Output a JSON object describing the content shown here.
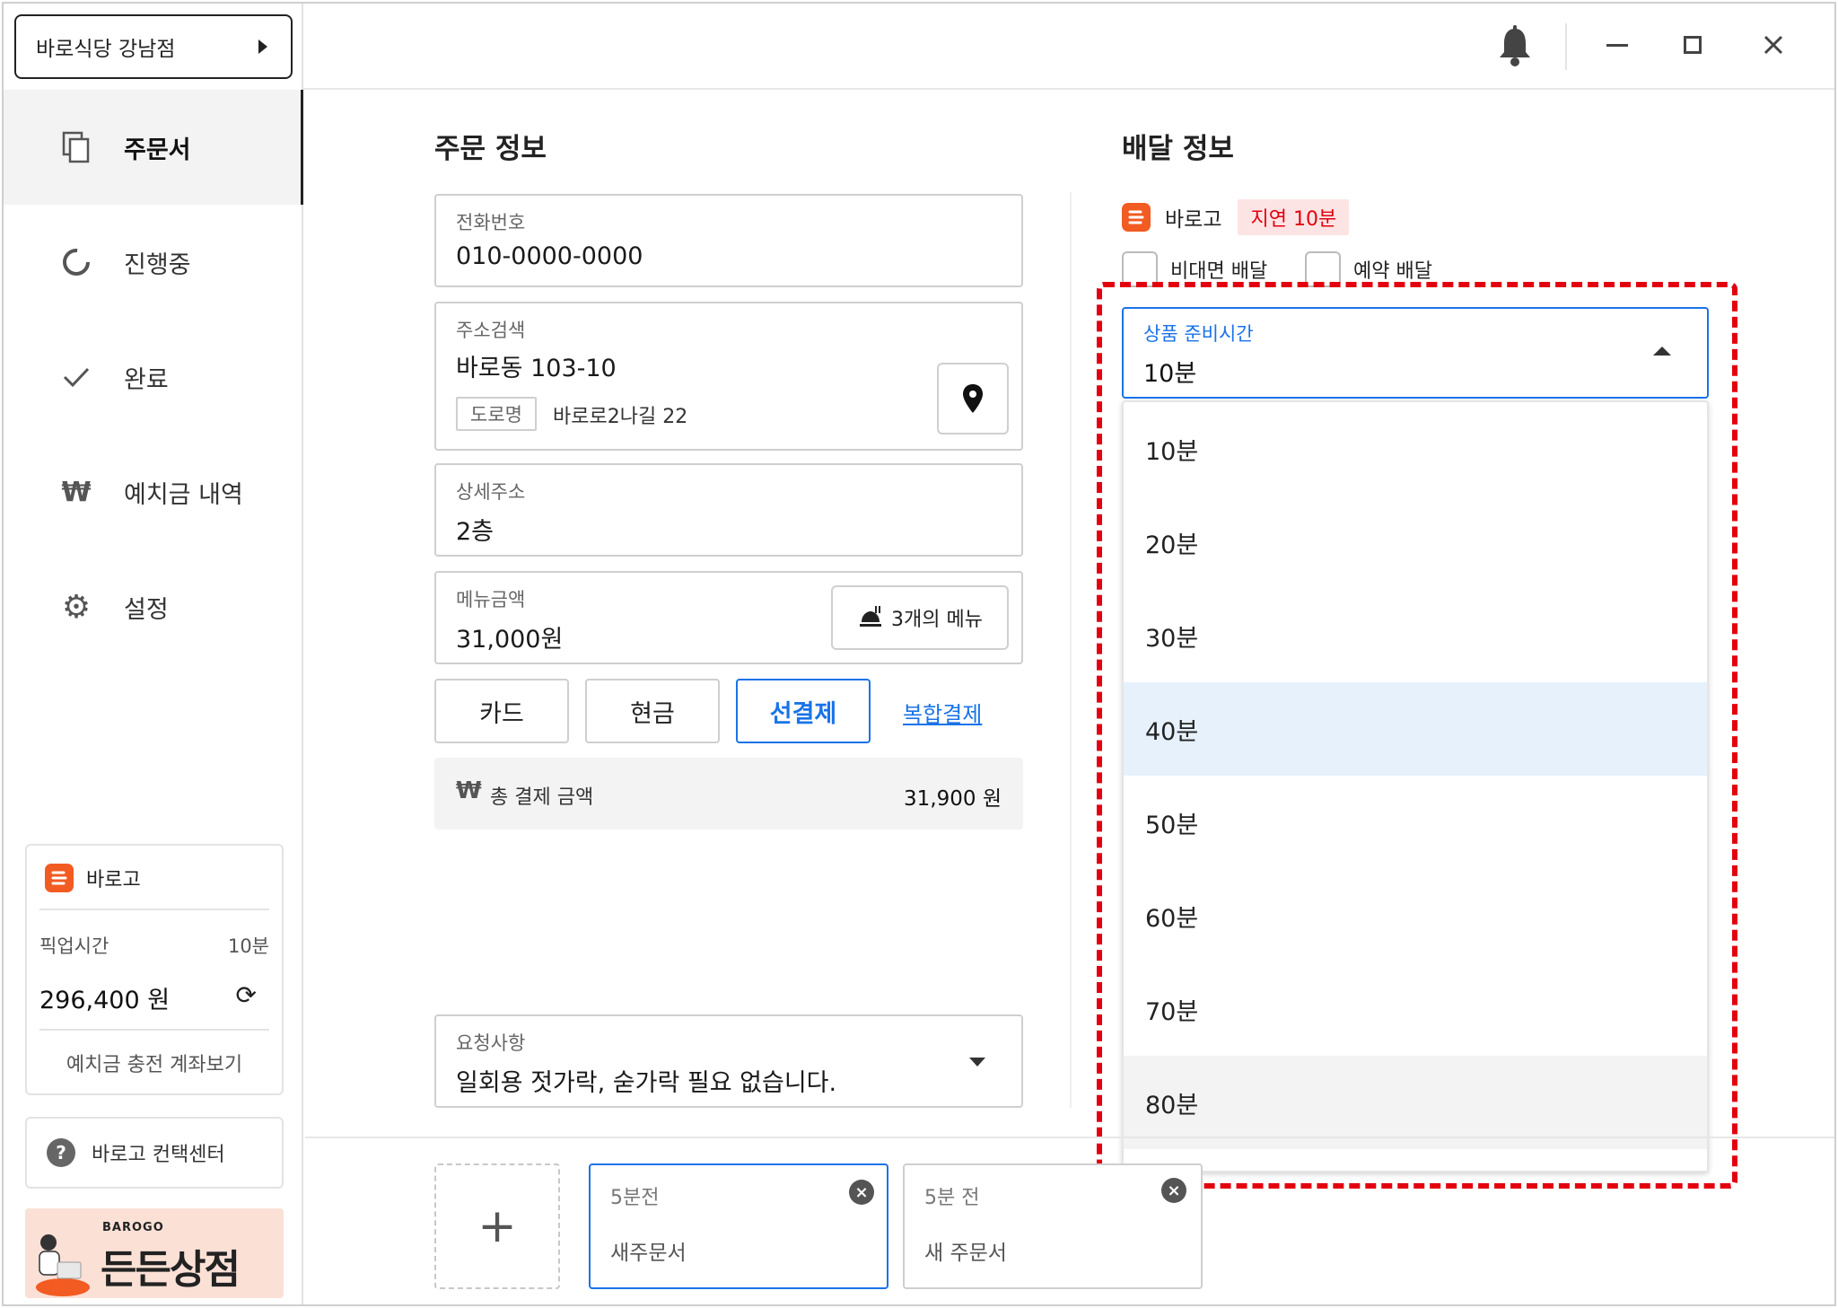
{
  "sidebar": {
    "store_name": "바로식당 강남점",
    "nav": [
      {
        "label": "주문서",
        "icon": "copy-icon"
      },
      {
        "label": "진행중",
        "icon": "progress-ring-icon"
      },
      {
        "label": "완료",
        "icon": "check-icon"
      },
      {
        "label": "예치금 내역",
        "icon": "won-icon"
      },
      {
        "label": "설정",
        "icon": "gear-icon"
      }
    ],
    "card": {
      "brand": "바로고",
      "pickup_label": "픽업시간",
      "pickup_value": "10분",
      "balance": "296,400 원",
      "deposit_link": "예치금 충전 계좌보기"
    },
    "help_label": "바로고 컨택센터",
    "banner": {
      "brand": "BAROGO",
      "title": "든든상점"
    }
  },
  "order_info": {
    "title": "주문 정보",
    "phone": {
      "label": "전화번호",
      "value": "010-0000-0000"
    },
    "address": {
      "label": "주소검색",
      "value": "바로동 103-10",
      "road_tag": "도로명",
      "road_value": "바로로2나길 22"
    },
    "detail": {
      "label": "상세주소",
      "value": "2층"
    },
    "menu": {
      "label": "메뉴금액",
      "value": "31,000원",
      "menu_button": "3개의 메뉴"
    },
    "payment": {
      "options": [
        "카드",
        "현금",
        "선결제"
      ],
      "selected": "선결제",
      "combo_link": "복합결제"
    },
    "total": {
      "label": "총 결제 금액",
      "value": "31,900 원"
    },
    "request": {
      "label": "요청사항",
      "value": "일회용 젓가락, 숟가락 필요 없습니다."
    }
  },
  "delivery_info": {
    "title": "배달 정보",
    "brand": "바로고",
    "delay_badge": "지연 10분",
    "contactless": "비대면 배달",
    "reserve": "예약 배달",
    "prep_time": {
      "label": "상품 준비시간",
      "value": "10분"
    },
    "options": [
      "10분",
      "20분",
      "30분",
      "40분",
      "50분",
      "60분",
      "70분",
      "80분"
    ],
    "highlighted_option": "40분",
    "hovered_option": "80분"
  },
  "tabs": [
    {
      "time": "5분전",
      "title": "새주문서",
      "active": true
    },
    {
      "time": "5분 전",
      "title": "새 주문서",
      "active": false
    }
  ],
  "colors": {
    "accent": "#1a73e8",
    "brand": "#f25b22",
    "highlight_outline": "#e3000f",
    "delay_badge_bg": "#fde4e4"
  }
}
